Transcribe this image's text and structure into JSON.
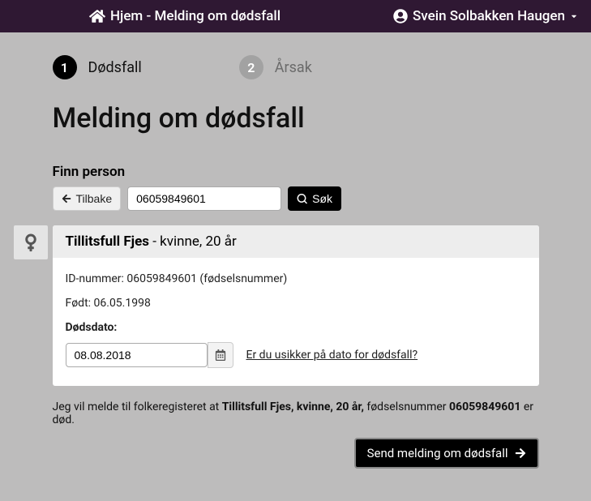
{
  "topbar": {
    "home_label": "Hjem - Melding om dødsfall",
    "user_name": "Svein Solbakken Haugen"
  },
  "steps": [
    {
      "num": "1",
      "label": "Dødsfall",
      "active": true
    },
    {
      "num": "2",
      "label": "Årsak",
      "active": false
    }
  ],
  "page_title": "Melding om dødsfall",
  "find_person_label": "Finn person",
  "back_label": "Tilbake",
  "search_value": "06059849601",
  "search_button": "Søk",
  "person": {
    "name": "Tillitsfull Fjes",
    "suffix": " - kvinne, 20 år",
    "id_line": "ID-nummer: 06059849601 (fødselsnummer)",
    "born_line": "Født: 06.05.1998",
    "death_label": "Dødsdato:",
    "death_value": "08.08.2018",
    "help_link": "Er du usikker på dato for dødsfall?"
  },
  "notice": {
    "prefix": "Jeg vil melde til folkeregisteret at ",
    "bold1": "Tillitsfull Fjes, kvinne, 20 år,",
    "mid": " fødselsnummer ",
    "bold2": "06059849601",
    "suffix": " er død."
  },
  "submit_label": "Send melding om dødsfall"
}
